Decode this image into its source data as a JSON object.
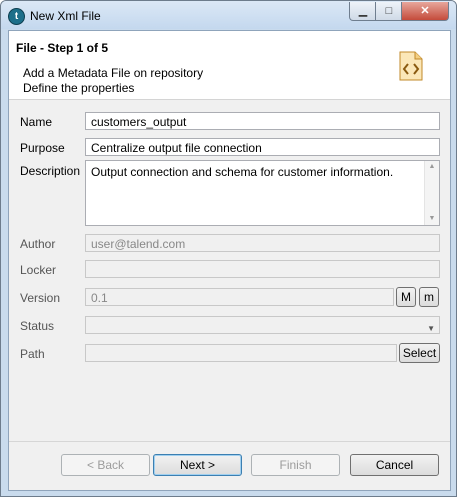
{
  "window": {
    "title": "New Xml File",
    "app_icon": "talend-icon",
    "controls": {
      "minimize": "minimize-icon",
      "maximize": "maximize-icon",
      "close": "close-icon"
    }
  },
  "header": {
    "step_title": "File - Step 1 of 5",
    "line1": "Add a Metadata File on repository",
    "line2": "Define the properties",
    "icon": "xml-file-icon"
  },
  "form": {
    "name_label": "Name",
    "name_value": "customers_output",
    "purpose_label": "Purpose",
    "purpose_value": "Centralize output file connection",
    "description_label": "Description",
    "description_value": "Output connection and schema for customer information.",
    "author_label": "Author",
    "author_value": "user@talend.com",
    "locker_label": "Locker",
    "locker_value": "",
    "version_label": "Version",
    "version_value": "0.1",
    "version_major_btn": "M",
    "version_minor_btn": "m",
    "status_label": "Status",
    "status_value": "",
    "path_label": "Path",
    "path_value": "",
    "select_btn": "Select"
  },
  "footer": {
    "back": "< Back",
    "next": "Next >",
    "finish": "Finish",
    "cancel": "Cancel"
  }
}
